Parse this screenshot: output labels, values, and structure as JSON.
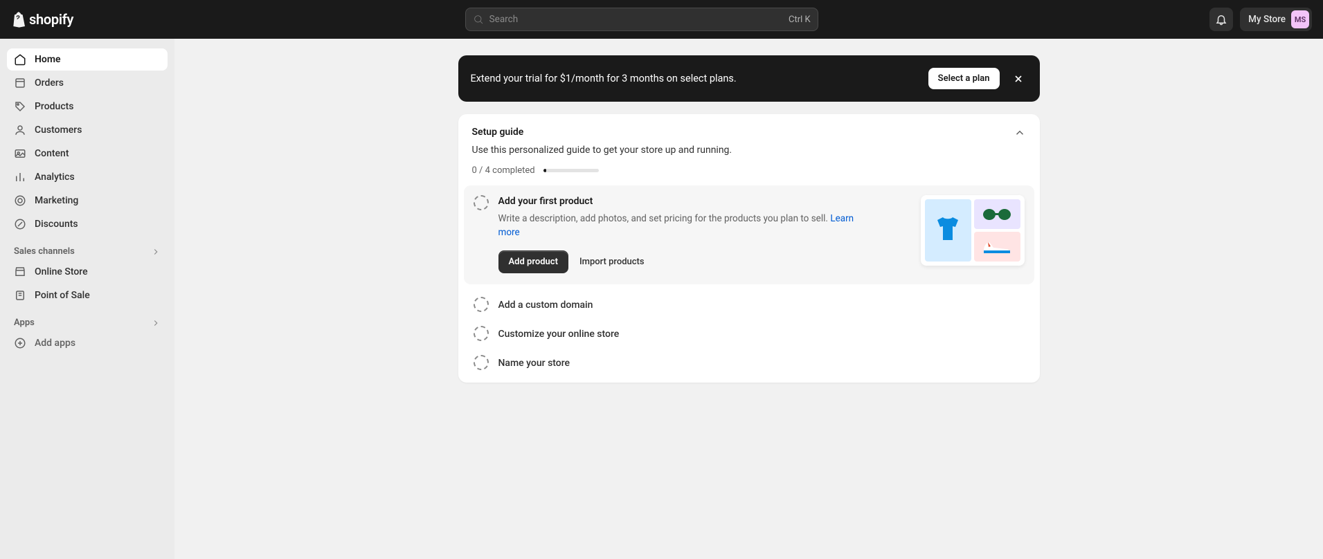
{
  "header": {
    "brand": "shopify",
    "search_placeholder": "Search",
    "search_shortcut": "Ctrl K",
    "store_name": "My Store",
    "avatar_initials": "MS"
  },
  "sidebar": {
    "nav": [
      {
        "label": "Home"
      },
      {
        "label": "Orders"
      },
      {
        "label": "Products"
      },
      {
        "label": "Customers"
      },
      {
        "label": "Content"
      },
      {
        "label": "Analytics"
      },
      {
        "label": "Marketing"
      },
      {
        "label": "Discounts"
      }
    ],
    "sales_channels_header": "Sales channels",
    "sales_channels": [
      {
        "label": "Online Store"
      },
      {
        "label": "Point of Sale"
      }
    ],
    "apps_header": "Apps",
    "add_apps_label": "Add apps"
  },
  "banner": {
    "text": "Extend your trial for $1/month for 3 months on select plans.",
    "cta": "Select a plan"
  },
  "setup": {
    "title": "Setup guide",
    "subtitle": "Use this personalized guide to get your store up and running.",
    "progress_text": "0 / 4 completed",
    "expanded_task": {
      "title": "Add your first product",
      "desc_pre": "Write a description, add photos, and set pricing for the products you plan to sell. ",
      "learn_more": "Learn more",
      "primary_btn": "Add product",
      "secondary_btn": "Import products"
    },
    "collapsed_tasks": [
      {
        "title": "Add a custom domain"
      },
      {
        "title": "Customize your online store"
      },
      {
        "title": "Name your store"
      }
    ]
  }
}
